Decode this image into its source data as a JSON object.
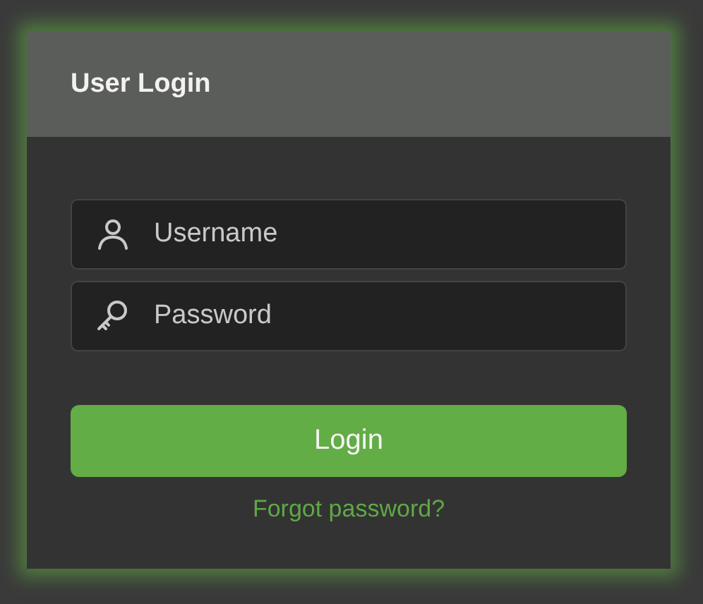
{
  "dialog": {
    "title": "User Login"
  },
  "fields": [
    {
      "kind": "user",
      "placeholder": "Username"
    },
    {
      "kind": "key",
      "placeholder": "Password"
    }
  ],
  "button": {
    "label": "Login"
  },
  "link": {
    "label": "Forgot password?"
  }
}
